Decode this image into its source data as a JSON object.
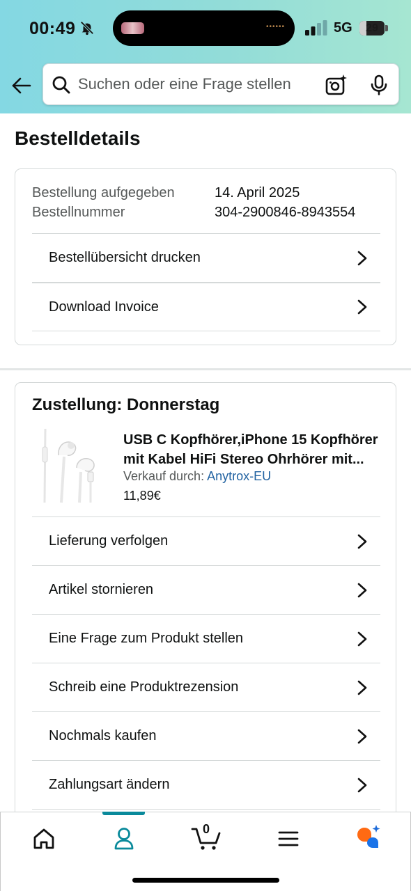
{
  "status_bar": {
    "time": "00:49",
    "network": "5G",
    "battery": "29",
    "battery_level_percent": 29
  },
  "header": {
    "search_placeholder": "Suchen oder eine Frage stellen",
    "icons": [
      "back-arrow-icon",
      "search-icon",
      "camera-sparkle-icon",
      "microphone-icon"
    ]
  },
  "page": {
    "title": "Bestelldetails"
  },
  "order_info": {
    "placed_label": "Bestellung aufgegeben",
    "placed_value": "14. April 2025",
    "number_label": "Bestellnummer",
    "number_value": "304-2900846-8943554",
    "actions": [
      {
        "label": "Bestellübersicht drucken"
      },
      {
        "label": "Download Invoice"
      }
    ]
  },
  "delivery": {
    "title": "Zustellung: Donnerstag",
    "product": {
      "title": "USB C Kopfhörer,iPhone 15 Kopfhörer mit Kabel HiFi Stereo Ohrhörer mit...",
      "seller_prefix": "Verkauf durch:",
      "seller_name": "Anytrox-EU",
      "price": "11,89€"
    },
    "actions": [
      {
        "label": "Lieferung verfolgen"
      },
      {
        "label": "Artikel stornieren"
      },
      {
        "label": "Eine Frage zum Produkt stellen"
      },
      {
        "label": "Schreib eine Produktrezension"
      },
      {
        "label": "Nochmals kaufen"
      },
      {
        "label": "Zahlungsart ändern"
      }
    ]
  },
  "bottom_nav": {
    "cart_count": "0",
    "items": [
      "home-icon",
      "account-icon",
      "cart-icon",
      "menu-icon",
      "rufus-icon"
    ],
    "active": "account-icon",
    "accent_color": "#0a8a9b"
  }
}
